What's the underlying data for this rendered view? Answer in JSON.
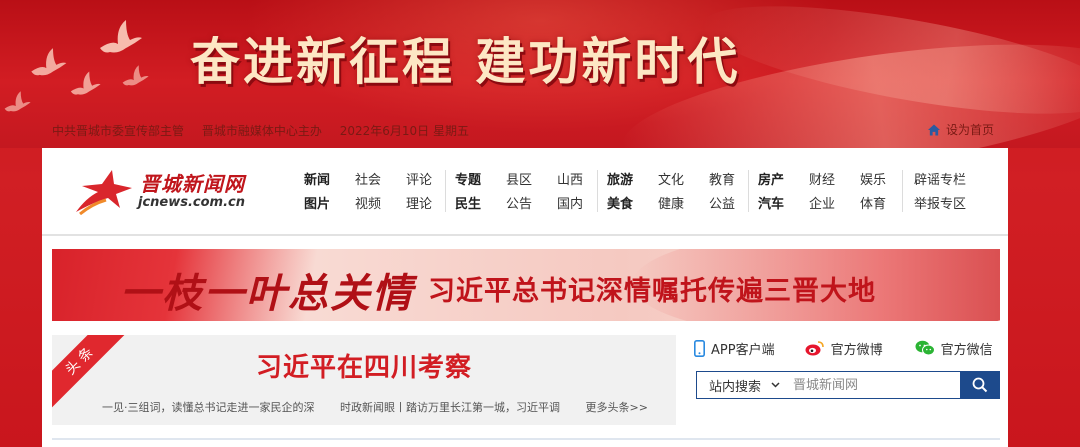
{
  "banner": {
    "slogan": "奋进新征程  建功新时代",
    "info": [
      "中共晋城市委宣传部主管",
      "晋城市融媒体中心主办",
      "2022年6月10日 星期五"
    ],
    "home_link": "设为首页"
  },
  "logo": {
    "cn": "晋城新闻网",
    "en": "jcnews.com.cn"
  },
  "nav": {
    "groups": [
      {
        "row1": [
          "新闻",
          "社会",
          "评论"
        ],
        "row2": [
          "图片",
          "视频",
          "理论"
        ]
      },
      {
        "row1": [
          "专题",
          "县区",
          "山西"
        ],
        "row2": [
          "民生",
          "公告",
          "国内"
        ]
      },
      {
        "row1": [
          "旅游",
          "文化",
          "教育"
        ],
        "row2": [
          "美食",
          "健康",
          "公益"
        ]
      },
      {
        "row1": [
          "房产",
          "财经",
          "娱乐"
        ],
        "row2": [
          "汽车",
          "企业",
          "体育"
        ]
      },
      {
        "row1": [
          "辟谣专栏"
        ],
        "row2": [
          "举报专区"
        ]
      }
    ]
  },
  "banner2": {
    "calligraphy": "一枝一叶总关情",
    "headline": "习近平总书记深情嘱托传遍三晋大地"
  },
  "headline_box": {
    "ribbon": "头条",
    "title": "习近平在四川考察",
    "subs": [
      "一见·三组词，读懂总书记走进一家民企的深",
      "时政新闻眼丨踏访万里长江第一城，习近平调",
      "更多头条>>"
    ]
  },
  "apps": [
    "APP客户端",
    "官方微博",
    "官方微信"
  ],
  "search": {
    "select_label": "站内搜索",
    "placeholder": "晋城新闻网"
  },
  "colors": {
    "brand_red": "#d21d23",
    "search_blue": "#1d4a8c"
  }
}
